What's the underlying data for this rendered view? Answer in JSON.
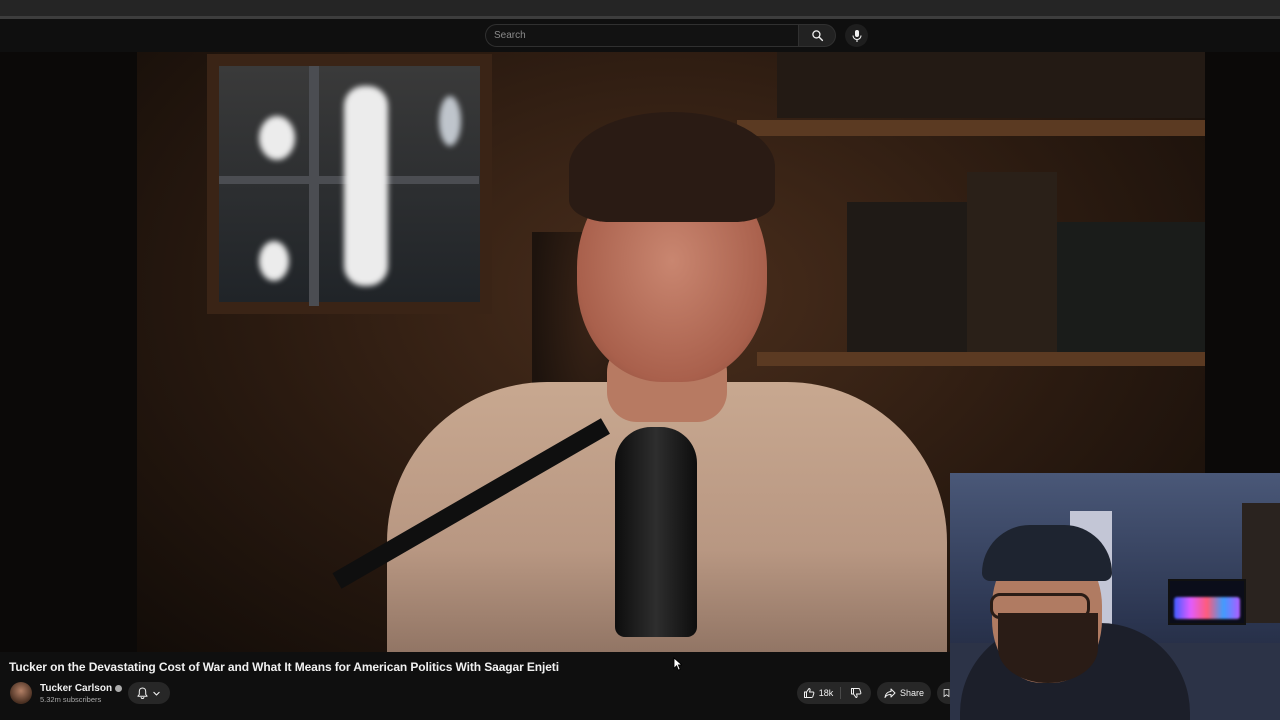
{
  "masthead": {
    "search_placeholder": "Search",
    "search_icon": "search-icon",
    "mic_icon": "microphone-icon"
  },
  "video": {
    "title": "Tucker on the Devastating Cost of War and What It Means for American Politics With Saagar Enjeti"
  },
  "channel": {
    "name": "Tucker Carlson",
    "subscribers": "5.32m subscribers",
    "verified_icon": "verified-badge-icon",
    "bell_icon": "bell-icon",
    "dropdown_icon": "chevron-down-icon"
  },
  "actions": {
    "like_count": "18k",
    "like_icon": "thumbs-up-icon",
    "dislike_icon": "thumbs-down-icon",
    "share_label": "Share",
    "share_icon": "share-arrow-icon"
  },
  "colors": {
    "background": "#0f0f0f",
    "button_bg": "#272727",
    "text": "#f1f1f1",
    "secondary_text": "#aaaaaa"
  }
}
